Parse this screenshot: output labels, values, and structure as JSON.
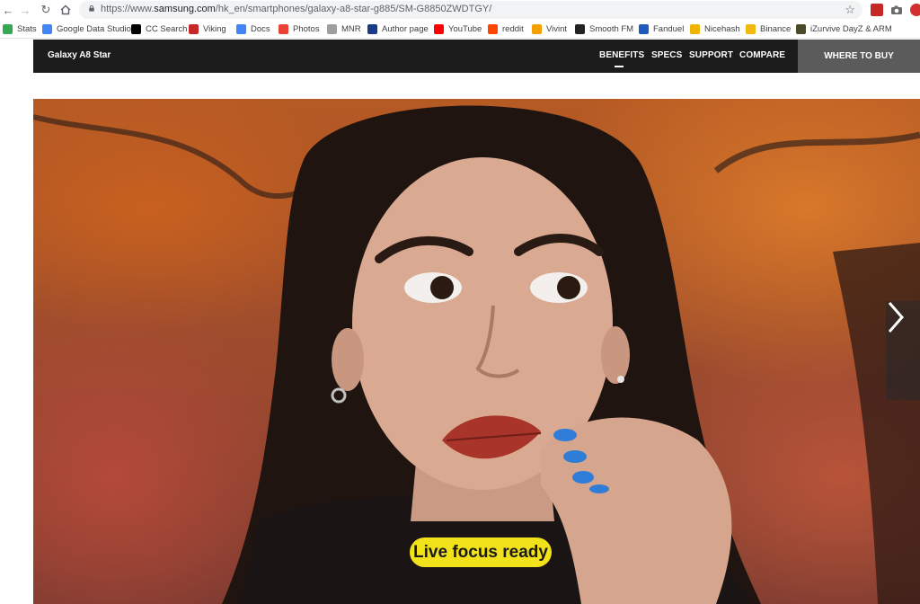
{
  "browser": {
    "url_prefix": "https://www.",
    "url_host": "samsung.com",
    "url_path": "/hk_en/smartphones/galaxy-a8-star-g885/SM-G8850ZWDTGY/",
    "bookmarks": [
      {
        "label": "Stats",
        "icon": "drive-icon",
        "color": "#34a853"
      },
      {
        "label": "Google Data Studio",
        "icon": "data-studio-icon",
        "color": "#4285f4"
      },
      {
        "label": "CC Search",
        "icon": "cc-icon",
        "color": "#000000"
      },
      {
        "label": "Viking",
        "icon": "bi-icon",
        "color": "#c62828"
      },
      {
        "label": "Docs",
        "icon": "docs-icon",
        "color": "#4285f4"
      },
      {
        "label": "Photos",
        "icon": "photos-icon",
        "color": "#ea4335"
      },
      {
        "label": "MNR",
        "icon": "page-icon",
        "color": "#9e9e9e"
      },
      {
        "label": "Author page",
        "icon": "bi-icon",
        "color": "#1a3a8a"
      },
      {
        "label": "YouTube",
        "icon": "youtube-icon",
        "color": "#ff0000"
      },
      {
        "label": "reddit",
        "icon": "reddit-icon",
        "color": "#ff4500"
      },
      {
        "label": "Vivint",
        "icon": "vivint-icon",
        "color": "#f4a100"
      },
      {
        "label": "Smooth FM",
        "icon": "smooth-icon",
        "color": "#222222"
      },
      {
        "label": "Fanduel",
        "icon": "fanduel-icon",
        "color": "#1e5bbd"
      },
      {
        "label": "Nicehash",
        "icon": "nicehash-icon",
        "color": "#f0b400"
      },
      {
        "label": "Binance",
        "icon": "binance-icon",
        "color": "#f0b90b"
      },
      {
        "label": "iZurvive DayZ & ARM",
        "icon": "izurvive-icon",
        "color": "#4a4a2a"
      }
    ]
  },
  "site": {
    "product_name": "Galaxy A8 Star",
    "nav": {
      "benefits": "BENEFITS",
      "specs": "SPECS",
      "support": "SUPPORT",
      "compare": "COMPARE",
      "where_to_buy": "WHERE TO BUY"
    }
  },
  "hero": {
    "caption": "Live focus ready",
    "next_icon": "chevron-right-icon"
  }
}
